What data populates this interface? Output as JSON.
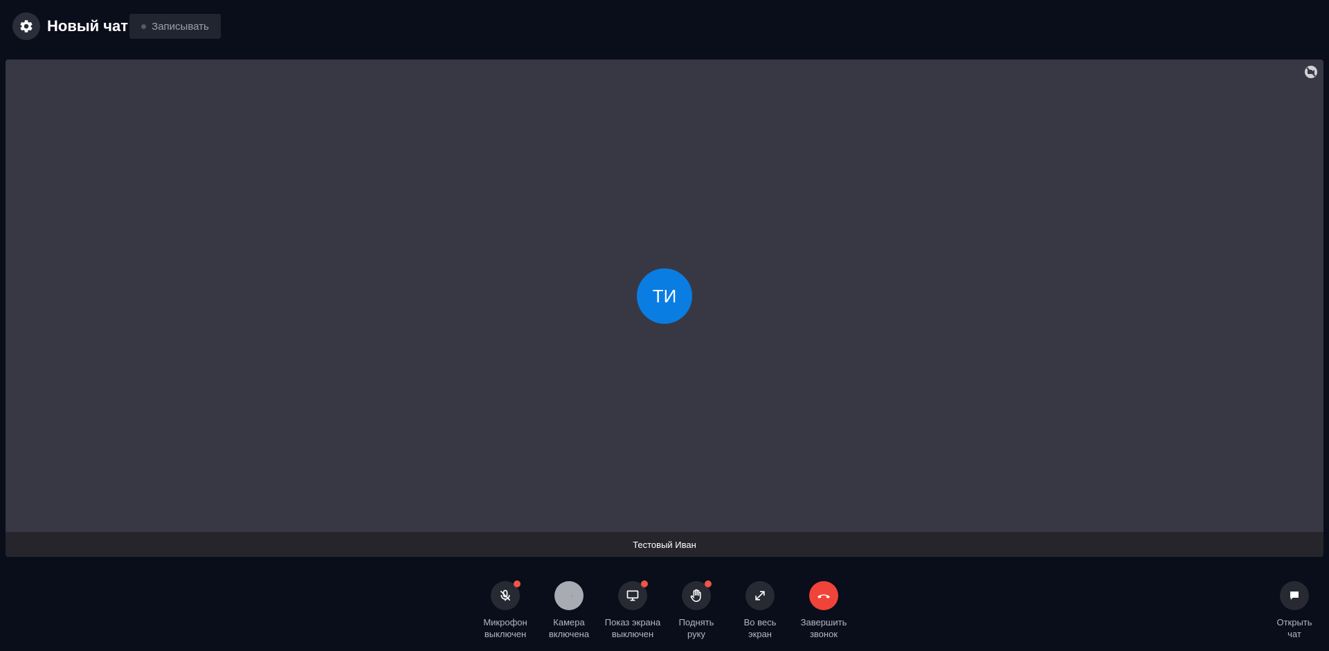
{
  "header": {
    "settings_icon": "gear-icon",
    "title": "Новый чат",
    "record_label": "Записывать"
  },
  "video": {
    "avatar_initials": "ТИ",
    "avatar_color": "#0a7de3",
    "participant_name": "Тестовый Иван",
    "status_icon": "video-off-icon"
  },
  "controls": [
    {
      "id": "mic",
      "icon": "microphone-off-icon",
      "line1": "Микрофон",
      "line2": "выключен",
      "badge": true
    },
    {
      "id": "camera",
      "icon": "camera-icon",
      "line1": "Камера",
      "line2": "включена",
      "badge": false
    },
    {
      "id": "screen",
      "icon": "monitor-icon",
      "line1": "Показ экрана",
      "line2": "выключен",
      "badge": true
    },
    {
      "id": "hand",
      "icon": "hand-icon",
      "line1": "Поднять",
      "line2": "руку",
      "badge": true
    },
    {
      "id": "fullscreen",
      "icon": "expand-icon",
      "line1": "Во весь",
      "line2": "экран",
      "badge": false
    },
    {
      "id": "end",
      "icon": "hang-up-icon",
      "line1": "Завершить",
      "line2": "звонок",
      "badge": false
    }
  ],
  "chat": {
    "icon": "chat-bubble-icon",
    "line1": "Открыть",
    "line2": "чат"
  },
  "colors": {
    "background": "#0a0d1a",
    "tile": "#383844",
    "end_call": "#f0433a",
    "badge": "#f05548"
  }
}
